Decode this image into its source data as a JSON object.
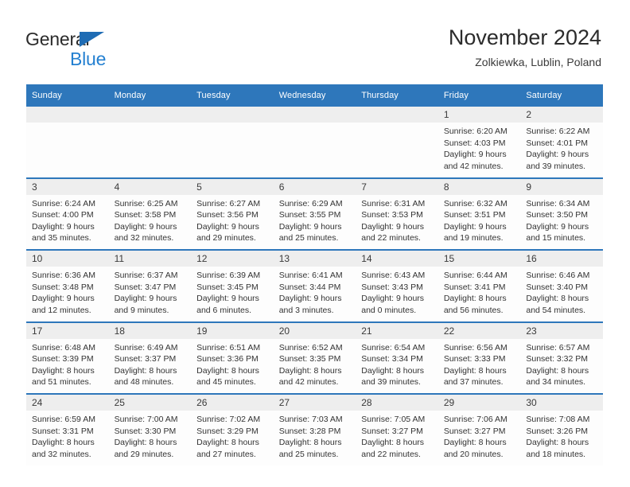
{
  "brand": {
    "name_part1": "General",
    "name_part2": "Blue",
    "logo_icon": "triangle-flag-icon",
    "accent_color": "#2480d1",
    "triangle_color": "#1f6cb4"
  },
  "header": {
    "title": "November 2024",
    "subtitle": "Zolkiewka, Lublin, Poland"
  },
  "theme": {
    "header_bg": "#2e77bb",
    "daynum_bg": "#eeeeee",
    "cell_bg": "#fdfdfd",
    "text": "#333333"
  },
  "weekday_headers": [
    "Sunday",
    "Monday",
    "Tuesday",
    "Wednesday",
    "Thursday",
    "Friday",
    "Saturday"
  ],
  "weeks": [
    [
      {
        "day": "",
        "sunrise": "",
        "sunset": "",
        "daylight_line1": "",
        "daylight_line2": ""
      },
      {
        "day": "",
        "sunrise": "",
        "sunset": "",
        "daylight_line1": "",
        "daylight_line2": ""
      },
      {
        "day": "",
        "sunrise": "",
        "sunset": "",
        "daylight_line1": "",
        "daylight_line2": ""
      },
      {
        "day": "",
        "sunrise": "",
        "sunset": "",
        "daylight_line1": "",
        "daylight_line2": ""
      },
      {
        "day": "",
        "sunrise": "",
        "sunset": "",
        "daylight_line1": "",
        "daylight_line2": ""
      },
      {
        "day": "1",
        "sunrise": "Sunrise: 6:20 AM",
        "sunset": "Sunset: 4:03 PM",
        "daylight_line1": "Daylight: 9 hours",
        "daylight_line2": "and 42 minutes."
      },
      {
        "day": "2",
        "sunrise": "Sunrise: 6:22 AM",
        "sunset": "Sunset: 4:01 PM",
        "daylight_line1": "Daylight: 9 hours",
        "daylight_line2": "and 39 minutes."
      }
    ],
    [
      {
        "day": "3",
        "sunrise": "Sunrise: 6:24 AM",
        "sunset": "Sunset: 4:00 PM",
        "daylight_line1": "Daylight: 9 hours",
        "daylight_line2": "and 35 minutes."
      },
      {
        "day": "4",
        "sunrise": "Sunrise: 6:25 AM",
        "sunset": "Sunset: 3:58 PM",
        "daylight_line1": "Daylight: 9 hours",
        "daylight_line2": "and 32 minutes."
      },
      {
        "day": "5",
        "sunrise": "Sunrise: 6:27 AM",
        "sunset": "Sunset: 3:56 PM",
        "daylight_line1": "Daylight: 9 hours",
        "daylight_line2": "and 29 minutes."
      },
      {
        "day": "6",
        "sunrise": "Sunrise: 6:29 AM",
        "sunset": "Sunset: 3:55 PM",
        "daylight_line1": "Daylight: 9 hours",
        "daylight_line2": "and 25 minutes."
      },
      {
        "day": "7",
        "sunrise": "Sunrise: 6:31 AM",
        "sunset": "Sunset: 3:53 PM",
        "daylight_line1": "Daylight: 9 hours",
        "daylight_line2": "and 22 minutes."
      },
      {
        "day": "8",
        "sunrise": "Sunrise: 6:32 AM",
        "sunset": "Sunset: 3:51 PM",
        "daylight_line1": "Daylight: 9 hours",
        "daylight_line2": "and 19 minutes."
      },
      {
        "day": "9",
        "sunrise": "Sunrise: 6:34 AM",
        "sunset": "Sunset: 3:50 PM",
        "daylight_line1": "Daylight: 9 hours",
        "daylight_line2": "and 15 minutes."
      }
    ],
    [
      {
        "day": "10",
        "sunrise": "Sunrise: 6:36 AM",
        "sunset": "Sunset: 3:48 PM",
        "daylight_line1": "Daylight: 9 hours",
        "daylight_line2": "and 12 minutes."
      },
      {
        "day": "11",
        "sunrise": "Sunrise: 6:37 AM",
        "sunset": "Sunset: 3:47 PM",
        "daylight_line1": "Daylight: 9 hours",
        "daylight_line2": "and 9 minutes."
      },
      {
        "day": "12",
        "sunrise": "Sunrise: 6:39 AM",
        "sunset": "Sunset: 3:45 PM",
        "daylight_line1": "Daylight: 9 hours",
        "daylight_line2": "and 6 minutes."
      },
      {
        "day": "13",
        "sunrise": "Sunrise: 6:41 AM",
        "sunset": "Sunset: 3:44 PM",
        "daylight_line1": "Daylight: 9 hours",
        "daylight_line2": "and 3 minutes."
      },
      {
        "day": "14",
        "sunrise": "Sunrise: 6:43 AM",
        "sunset": "Sunset: 3:43 PM",
        "daylight_line1": "Daylight: 9 hours",
        "daylight_line2": "and 0 minutes."
      },
      {
        "day": "15",
        "sunrise": "Sunrise: 6:44 AM",
        "sunset": "Sunset: 3:41 PM",
        "daylight_line1": "Daylight: 8 hours",
        "daylight_line2": "and 56 minutes."
      },
      {
        "day": "16",
        "sunrise": "Sunrise: 6:46 AM",
        "sunset": "Sunset: 3:40 PM",
        "daylight_line1": "Daylight: 8 hours",
        "daylight_line2": "and 54 minutes."
      }
    ],
    [
      {
        "day": "17",
        "sunrise": "Sunrise: 6:48 AM",
        "sunset": "Sunset: 3:39 PM",
        "daylight_line1": "Daylight: 8 hours",
        "daylight_line2": "and 51 minutes."
      },
      {
        "day": "18",
        "sunrise": "Sunrise: 6:49 AM",
        "sunset": "Sunset: 3:37 PM",
        "daylight_line1": "Daylight: 8 hours",
        "daylight_line2": "and 48 minutes."
      },
      {
        "day": "19",
        "sunrise": "Sunrise: 6:51 AM",
        "sunset": "Sunset: 3:36 PM",
        "daylight_line1": "Daylight: 8 hours",
        "daylight_line2": "and 45 minutes."
      },
      {
        "day": "20",
        "sunrise": "Sunrise: 6:52 AM",
        "sunset": "Sunset: 3:35 PM",
        "daylight_line1": "Daylight: 8 hours",
        "daylight_line2": "and 42 minutes."
      },
      {
        "day": "21",
        "sunrise": "Sunrise: 6:54 AM",
        "sunset": "Sunset: 3:34 PM",
        "daylight_line1": "Daylight: 8 hours",
        "daylight_line2": "and 39 minutes."
      },
      {
        "day": "22",
        "sunrise": "Sunrise: 6:56 AM",
        "sunset": "Sunset: 3:33 PM",
        "daylight_line1": "Daylight: 8 hours",
        "daylight_line2": "and 37 minutes."
      },
      {
        "day": "23",
        "sunrise": "Sunrise: 6:57 AM",
        "sunset": "Sunset: 3:32 PM",
        "daylight_line1": "Daylight: 8 hours",
        "daylight_line2": "and 34 minutes."
      }
    ],
    [
      {
        "day": "24",
        "sunrise": "Sunrise: 6:59 AM",
        "sunset": "Sunset: 3:31 PM",
        "daylight_line1": "Daylight: 8 hours",
        "daylight_line2": "and 32 minutes."
      },
      {
        "day": "25",
        "sunrise": "Sunrise: 7:00 AM",
        "sunset": "Sunset: 3:30 PM",
        "daylight_line1": "Daylight: 8 hours",
        "daylight_line2": "and 29 minutes."
      },
      {
        "day": "26",
        "sunrise": "Sunrise: 7:02 AM",
        "sunset": "Sunset: 3:29 PM",
        "daylight_line1": "Daylight: 8 hours",
        "daylight_line2": "and 27 minutes."
      },
      {
        "day": "27",
        "sunrise": "Sunrise: 7:03 AM",
        "sunset": "Sunset: 3:28 PM",
        "daylight_line1": "Daylight: 8 hours",
        "daylight_line2": "and 25 minutes."
      },
      {
        "day": "28",
        "sunrise": "Sunrise: 7:05 AM",
        "sunset": "Sunset: 3:27 PM",
        "daylight_line1": "Daylight: 8 hours",
        "daylight_line2": "and 22 minutes."
      },
      {
        "day": "29",
        "sunrise": "Sunrise: 7:06 AM",
        "sunset": "Sunset: 3:27 PM",
        "daylight_line1": "Daylight: 8 hours",
        "daylight_line2": "and 20 minutes."
      },
      {
        "day": "30",
        "sunrise": "Sunrise: 7:08 AM",
        "sunset": "Sunset: 3:26 PM",
        "daylight_line1": "Daylight: 8 hours",
        "daylight_line2": "and 18 minutes."
      }
    ]
  ]
}
